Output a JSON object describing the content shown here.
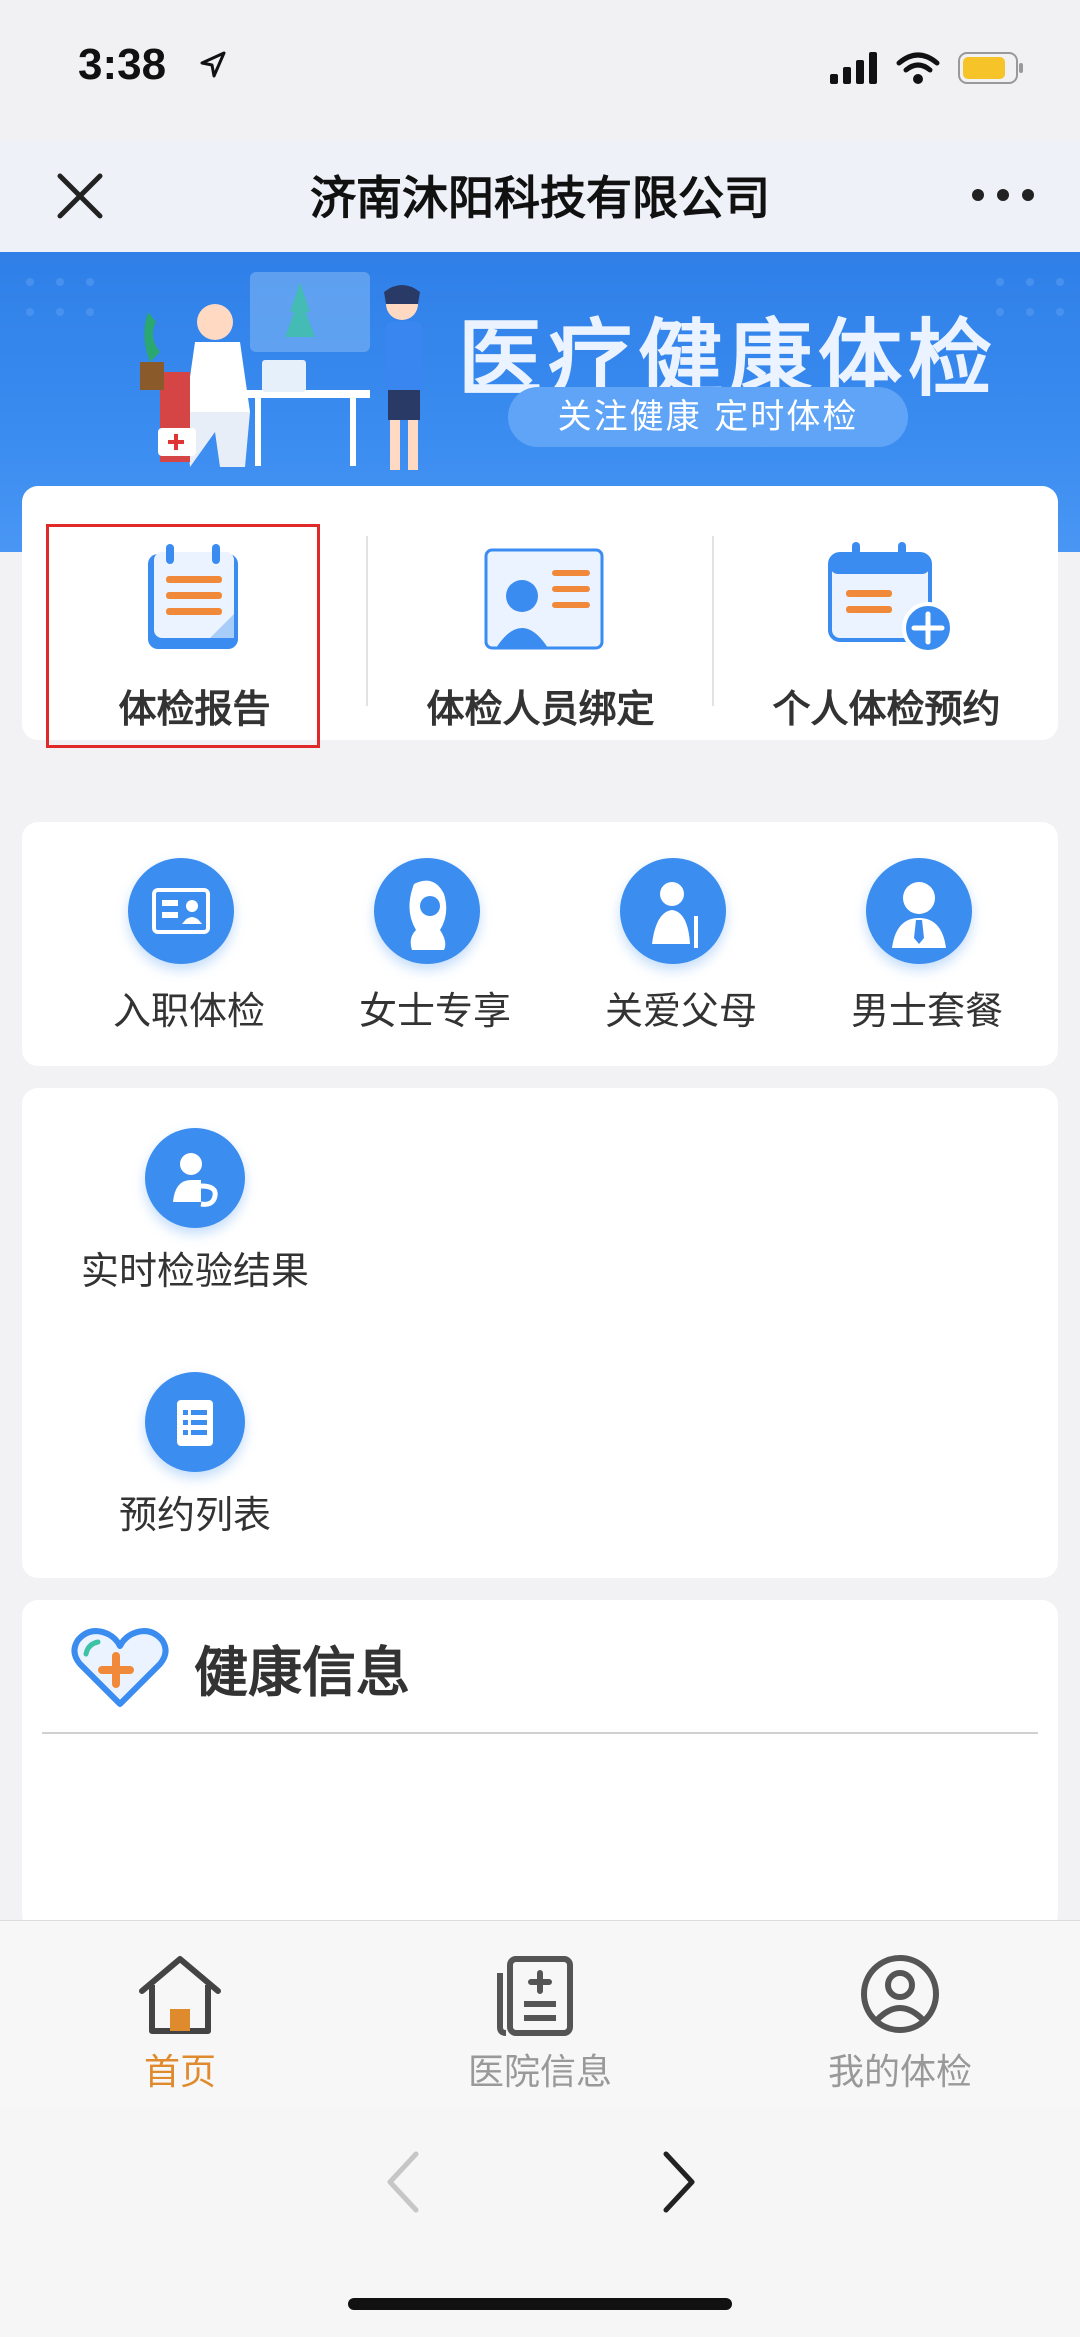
{
  "status_bar": {
    "time": "3:38"
  },
  "nav": {
    "title": "济南沐阳科技有限公司"
  },
  "banner": {
    "title": "医疗健康体检",
    "subtitle": "关注健康  定时体检"
  },
  "quick_actions": [
    {
      "label": "体检报告",
      "icon": "report-icon"
    },
    {
      "label": "体检人员绑定",
      "icon": "person-card-icon"
    },
    {
      "label": "个人体检预约",
      "icon": "calendar-add-icon"
    }
  ],
  "categories": [
    {
      "label": "入职体检",
      "icon": "id-card-icon"
    },
    {
      "label": "女士专享",
      "icon": "woman-icon"
    },
    {
      "label": "关爱父母",
      "icon": "elder-icon"
    },
    {
      "label": "男士套餐",
      "icon": "man-icon"
    }
  ],
  "tools": [
    {
      "label": "实时检验结果",
      "icon": "lab-result-icon"
    },
    {
      "label": "预约列表",
      "icon": "list-icon"
    }
  ],
  "health_info": {
    "title": "健康信息"
  },
  "tabs": [
    {
      "label": "首页",
      "icon": "home-icon",
      "active": true
    },
    {
      "label": "医院信息",
      "icon": "hospital-info-icon",
      "active": false
    },
    {
      "label": "我的体检",
      "icon": "user-icon",
      "active": false
    }
  ],
  "colors": {
    "accent": "#3c8df0",
    "tab_active": "#e08a2e",
    "tab_inactive": "#999999",
    "highlight_border": "#e02a2a"
  }
}
